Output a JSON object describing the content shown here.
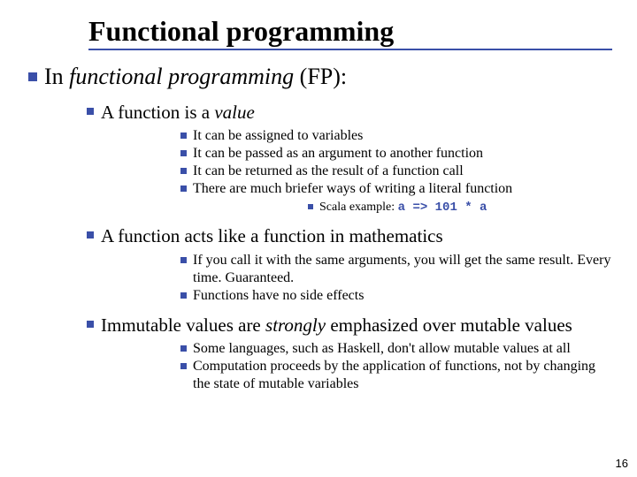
{
  "title": "Functional programming",
  "l1": {
    "prefix": "In ",
    "em": "functional programming",
    "suffix": " (FP):"
  },
  "l2a": {
    "prefix": "A function is a ",
    "em": "value"
  },
  "l3a1": "It can be assigned to variables",
  "l3a2": "It can be passed as an argument to another function",
  "l3a3": "It can be returned as the result of a function call",
  "l3a4": "There are much briefer ways of writing a literal function",
  "l4a": {
    "prefix": "Scala example: ",
    "code": "a => 101 * a"
  },
  "l2b": "A function acts like a function in mathematics",
  "l3b1": "If you call it with the same arguments, you will get the same result. Every time. Guaranteed.",
  "l3b2": "Functions have no side effects",
  "l2c": {
    "prefix": "Immutable values are ",
    "em": "strongly",
    "suffix": " emphasized over mutable values"
  },
  "l3c1": "Some languages, such as Haskell, don't allow mutable values at all",
  "l3c2": "Computation proceeds by the application of functions, not by changing the state of mutable variables",
  "page_number": "16"
}
